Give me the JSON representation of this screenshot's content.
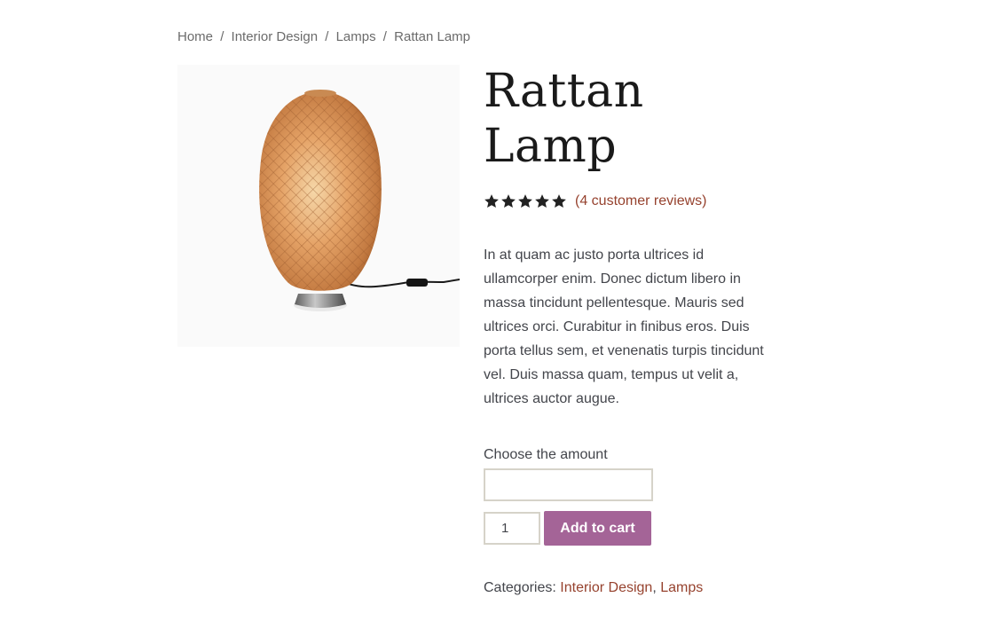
{
  "breadcrumb": {
    "items": [
      "Home",
      "Interior Design",
      "Lamps",
      "Rattan Lamp"
    ],
    "separator": "/"
  },
  "product": {
    "image_icon": "rattan-lamp-image",
    "title_line1": "Rattan",
    "title_line2": "Lamp",
    "rating": {
      "stars": 5,
      "max": 5,
      "reviews_link": "(4 customer reviews)"
    },
    "description": "In at quam ac justo porta ultrices id ullamcorper enim. Donec dictum libero in massa tincidunt pellentesque. Mauris sed ultrices orci. Curabitur in finibus eros. Duis porta tellus sem, et venenatis turpis tincidunt vel. Duis massa quam, tempus ut velit a, ultrices auctor augue.",
    "amount_label": "Choose the amount",
    "amount_value": "",
    "quantity": "1",
    "add_to_cart_label": "Add to cart",
    "categories_label": "Categories:",
    "categories": [
      "Interior Design",
      "Lamps"
    ],
    "categories_separator": ","
  },
  "colors": {
    "accent_link": "#96422e",
    "button": "#a46497",
    "star": "#222222"
  }
}
